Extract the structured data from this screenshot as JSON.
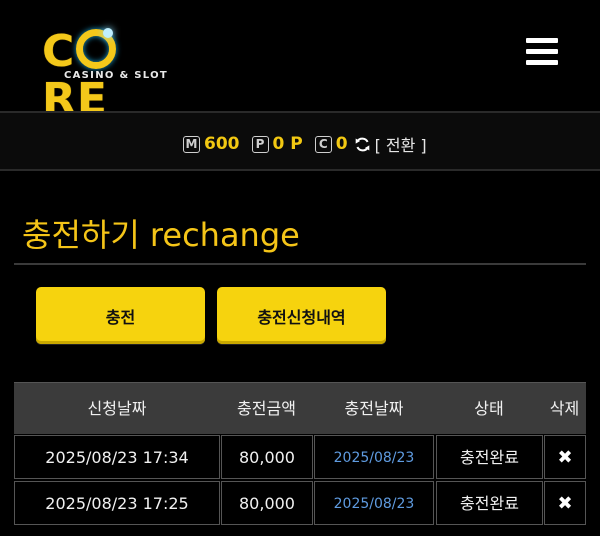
{
  "header": {
    "logo_text": "C  RE",
    "logo_sub": "CASINO & SLOT"
  },
  "points": {
    "m_label": "M",
    "m_value": "600",
    "p_label": "P",
    "p_value": "0 P",
    "c_label": "C",
    "c_value": "0",
    "switch_text": "[ 전환 ]"
  },
  "title": "충전하기 rechange",
  "buttons": {
    "charge": "충전",
    "history": "충전신청내역"
  },
  "table": {
    "headers": [
      "신청날짜",
      "충전금액",
      "충전날짜",
      "상태",
      "삭제"
    ],
    "rows": [
      {
        "request_date": "2025/08/23 17:34",
        "amount": "80,000",
        "charge_date": "2025/08/23",
        "status": "충전완료",
        "delete": "✖"
      },
      {
        "request_date": "2025/08/23 17:25",
        "amount": "80,000",
        "charge_date": "2025/08/23",
        "status": "충전완료",
        "delete": "✖"
      }
    ]
  },
  "colors": {
    "accent_yellow": "#f6d30e",
    "link_blue": "#5f9be0",
    "background": "#000000"
  }
}
